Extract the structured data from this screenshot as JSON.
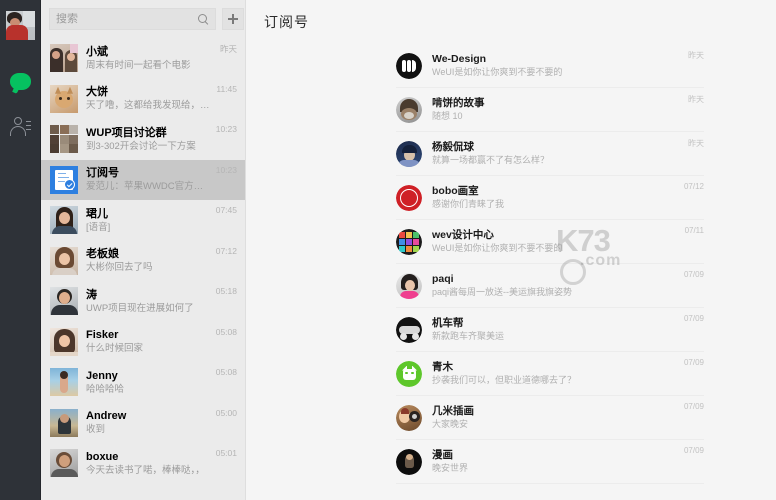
{
  "rail": {
    "avatar_name": "user-avatar",
    "items": [
      {
        "name": "chat-tab",
        "icon": "chat-bubble-icon",
        "active": true
      },
      {
        "name": "contacts-tab",
        "icon": "contacts-icon",
        "active": false
      }
    ]
  },
  "search": {
    "placeholder": "搜索",
    "value": "",
    "search_icon": "search-icon",
    "add_label": "+",
    "add_icon": "plus-icon"
  },
  "chats": [
    {
      "name": "小斌",
      "message": "周末有时间一起看个电影",
      "time": "昨天",
      "avatar": "photo-couple",
      "active": false
    },
    {
      "name": "大饼",
      "message": "天了噜，这都给我发现给，你知道...",
      "time": "11:45",
      "avatar": "photo-cat",
      "active": false
    },
    {
      "name": "WUP项目讨论群",
      "message": "到3-302开会讨论一下方案",
      "time": "10:23",
      "avatar": "group-grid",
      "active": false
    },
    {
      "name": "订阅号",
      "message": "爱范儿：苹果WWDC官方时间...",
      "time": "10:23",
      "avatar": "subscription",
      "active": true
    },
    {
      "name": "珺儿",
      "message": "[语音]",
      "time": "07:45",
      "avatar": "photo-girl1",
      "active": false
    },
    {
      "name": "老板娘",
      "message": "大彬你回去了吗",
      "time": "07:12",
      "avatar": "photo-girl2",
      "active": false
    },
    {
      "name": "涛",
      "message": "UWP项目现在进展如何了",
      "time": "05:18",
      "avatar": "photo-man1",
      "active": false
    },
    {
      "name": "Fisker",
      "message": "什么时候回家",
      "time": "05:08",
      "avatar": "photo-girl3",
      "active": false
    },
    {
      "name": "Jenny",
      "message": "哈哈哈哈",
      "time": "05:08",
      "avatar": "photo-beach",
      "active": false
    },
    {
      "name": "Andrew",
      "message": "收到",
      "time": "05:00",
      "avatar": "photo-man2",
      "active": false
    },
    {
      "name": "boxue",
      "message": "今天去读书了喏，棒棒哒，，",
      "time": "05:01",
      "avatar": "photo-man3",
      "active": false
    }
  ],
  "main": {
    "title": "订阅号"
  },
  "subscriptions": [
    {
      "name": "We-Design",
      "message": "WeUI是如你让你爽到不要不要的",
      "date": "昨天",
      "avatar": "wedesign-logo"
    },
    {
      "name": "啃饼的故事",
      "message": "随想 10",
      "date": "昨天",
      "avatar": "photo-bear"
    },
    {
      "name": "杨毅侃球",
      "message": "就算一场都赢不了有怎么样？",
      "date": "昨天",
      "avatar": "photo-night"
    },
    {
      "name": "bobo画室",
      "message": "感谢你们青睐了我",
      "date": "07/12",
      "avatar": "bobo-logo"
    },
    {
      "name": "wev设计中心",
      "message": "WeUI是如你让你爽到不要不要的",
      "date": "07/11",
      "avatar": "colorful-logo"
    },
    {
      "name": "paqi",
      "message": "paqi酱每周一放送--美运旗我旗姿势",
      "date": "07/09",
      "avatar": "photo-paqi"
    },
    {
      "name": "机车帮",
      "message": "新款跑车齐聚美运",
      "date": "07/09",
      "avatar": "moto-logo"
    },
    {
      "name": "青木",
      "message": "抄袭我们可以，但职业道德哪去了？",
      "date": "07/09",
      "avatar": "green-logo"
    },
    {
      "name": "几米插画",
      "message": "大家晚安",
      "date": "07/09",
      "avatar": "photo-jimi"
    },
    {
      "name": "漫画",
      "message": "晚安世界",
      "date": "07/09",
      "avatar": "photo-manga"
    }
  ],
  "watermark": {
    "primary": "K73",
    "secondary": ".com"
  },
  "colors": {
    "accent_green": "#06c160",
    "rail_bg": "#2e3238",
    "chatlist_bg": "#ebebeb",
    "selected_row": "#c8c8c8",
    "main_bg": "#f5f5f5"
  }
}
